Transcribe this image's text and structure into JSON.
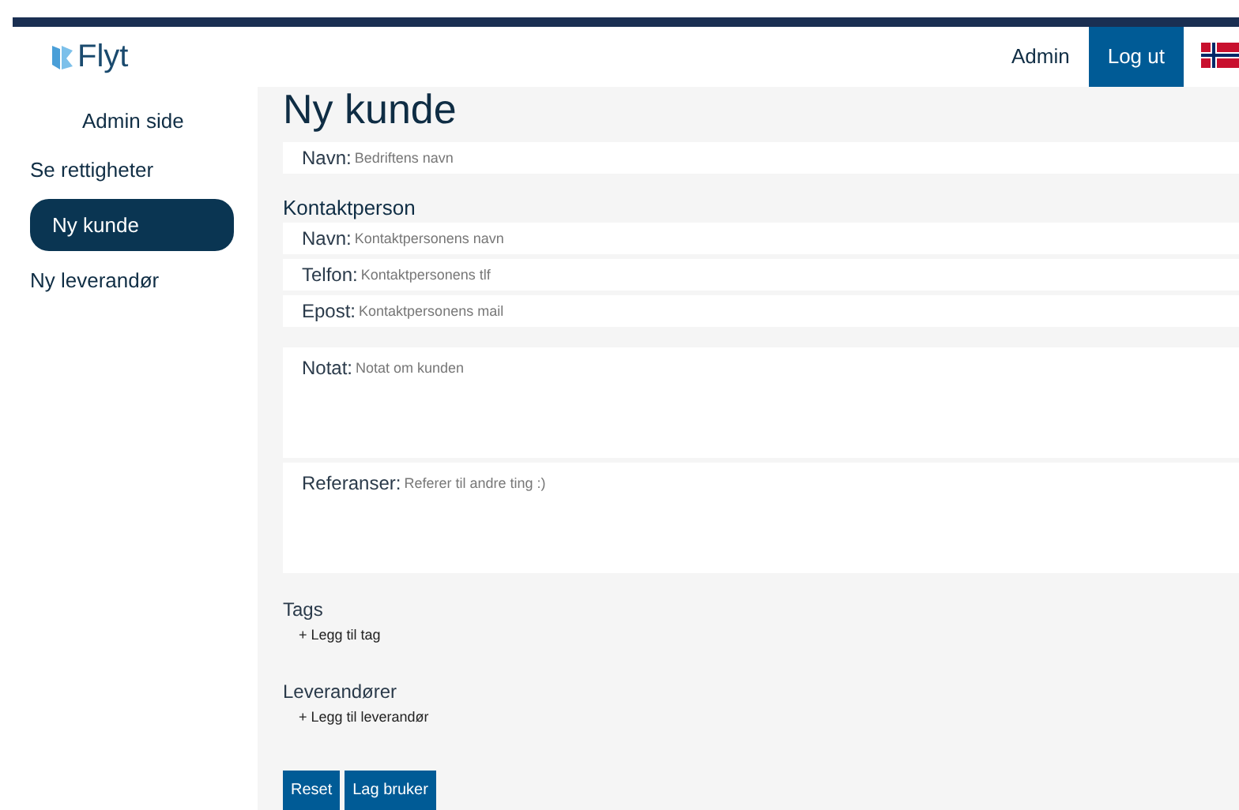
{
  "header": {
    "logo": "Flyt",
    "links": [
      {
        "label": "Admin",
        "selected": false
      },
      {
        "label": "Log ut",
        "selected": true
      }
    ]
  },
  "sidebar": {
    "title": "Admin side",
    "items": [
      {
        "label": "Se rettigheter",
        "selected": false
      },
      {
        "label": "Ny kunde",
        "selected": true
      },
      {
        "label": "Ny leverandør",
        "selected": false
      }
    ]
  },
  "page_title": "Ny kunde",
  "company_field": {
    "label": "Navn:",
    "placeholder": "Bedriftens navn"
  },
  "contact": {
    "heading": "Kontaktperson",
    "fields": [
      {
        "label": "Navn:",
        "placeholder": "Kontaktpersonens navn"
      },
      {
        "label": "Telfon:",
        "placeholder": "Kontaktpersonens tlf"
      },
      {
        "label": "Epost:",
        "placeholder": "Kontaktpersonens mail"
      }
    ]
  },
  "text_areas": [
    {
      "label": "Notat:",
      "placeholder": "Notat om kunden"
    },
    {
      "label": "Referanser:",
      "placeholder": "Referer til andre ting :)"
    }
  ],
  "sections": [
    {
      "heading": "Tags",
      "add_link": "+ Legg til tag"
    },
    {
      "heading": "Leverandører",
      "add_link": "+ Legg til leverandør"
    }
  ],
  "buttons": [
    "Reset",
    "Lag bruker"
  ]
}
